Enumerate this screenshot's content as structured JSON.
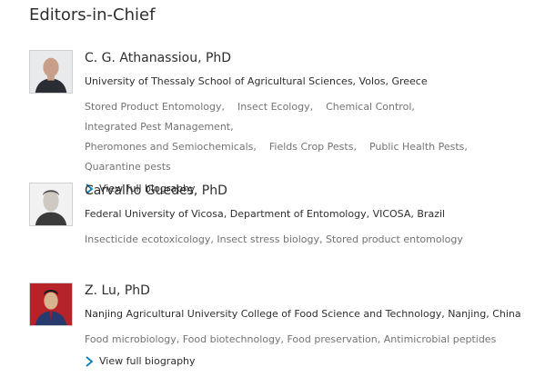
{
  "section": {
    "title": "Editors-in-Chief"
  },
  "colors": {
    "link_chevron": "#0c7db7",
    "muted_text": "#737373",
    "text": "#2e2e2e"
  },
  "editors": [
    {
      "name": "C. G. Athanassiou, PhD",
      "affiliation": "University of Thessaly School of Agricultural Sciences, Volos, Greece",
      "interests": [
        "Stored Product Entomology,",
        "Insect Ecology,",
        "Chemical Control,",
        "Integrated Pest Management,",
        "Pheromones and Semiochemicals,",
        "Fields Crop Pests,",
        "Public Health Pests,",
        "Quarantine pests"
      ],
      "bio_link": "View full biography"
    },
    {
      "name": "Carvalho Guedes, PhD",
      "affiliation": "Federal University of Vicosa, Department of Entomology, VICOSA, Brazil",
      "interests_text": "Insecticide ecotoxicology, Insect stress biology, Stored product entomology"
    },
    {
      "name": "Z. Lu, PhD",
      "affiliation": "Nanjing Agricultural University College of Food Science and Technology, Nanjing, China",
      "interests_text": "Food microbiology, Food biotechnology, Food preservation, Antimicrobial peptides",
      "bio_link": "View full biography"
    }
  ]
}
